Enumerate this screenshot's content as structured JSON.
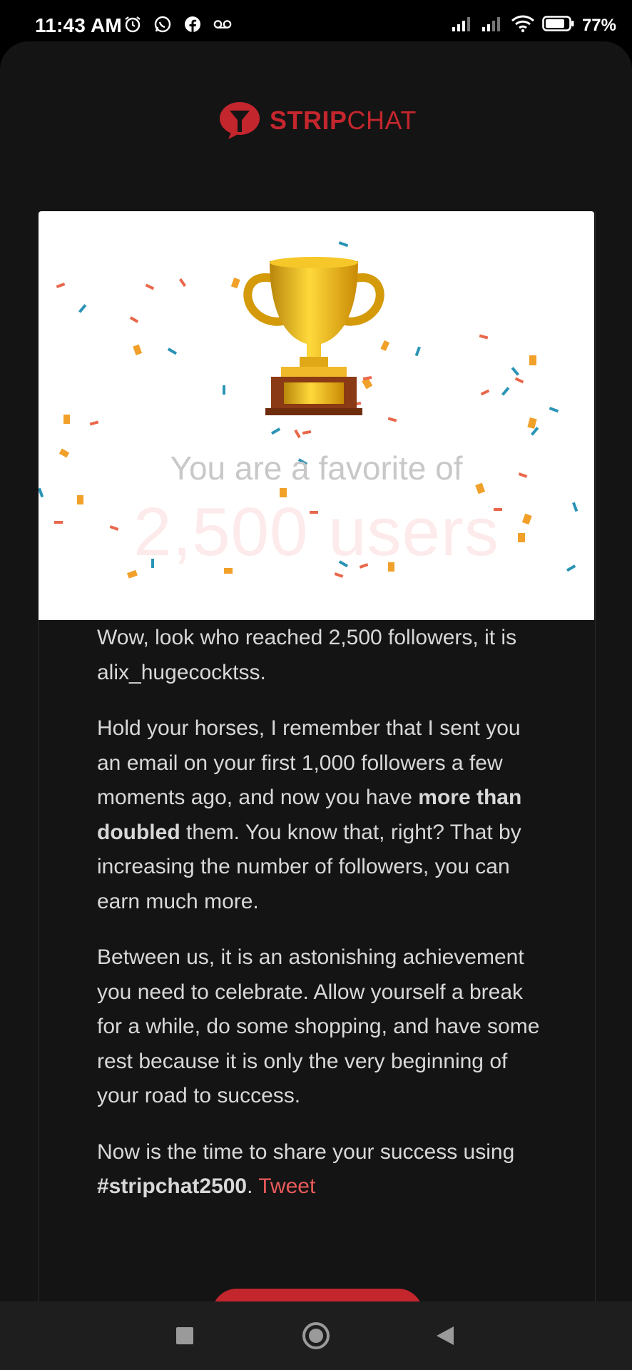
{
  "status_bar": {
    "time": "11:43 AM",
    "battery_percent": "77%",
    "icons": [
      "alarm-icon",
      "whatsapp-icon",
      "facebook-icon",
      "voicemail-icon",
      "signal-icon",
      "signal-icon",
      "wifi-icon",
      "battery-icon"
    ]
  },
  "brand": {
    "logo_bold": "STRIP",
    "logo_light": "CHAT",
    "color": "#c3262d"
  },
  "hero": {
    "subtitle": "You are a favorite of",
    "headline": "2,500 users"
  },
  "body": {
    "p1": "Wow, look who reached 2,500 followers, it is alix_hugecocktss.",
    "p2_before": "Hold your horses, I remember that I sent you an email on your first 1,000 followers a few moments ago, and now you have ",
    "p2_bold": "more than doubled",
    "p2_after": " them. You know that, right? That by increasing the number of followers, you can earn much more.",
    "p3": "Between us, it is an astonishing achievement you need to celebrate. Allow yourself a break for a while, do some shopping, and have some rest because it is only the very beginning of your road to success.",
    "p4_before": "Now is the time to share your success using ",
    "p4_hashtag": "#stripchat2500",
    "p4_period": ".",
    "tweet_link": "Tweet"
  },
  "nav": {
    "buttons": [
      "recents-icon",
      "home-icon",
      "back-icon"
    ]
  }
}
